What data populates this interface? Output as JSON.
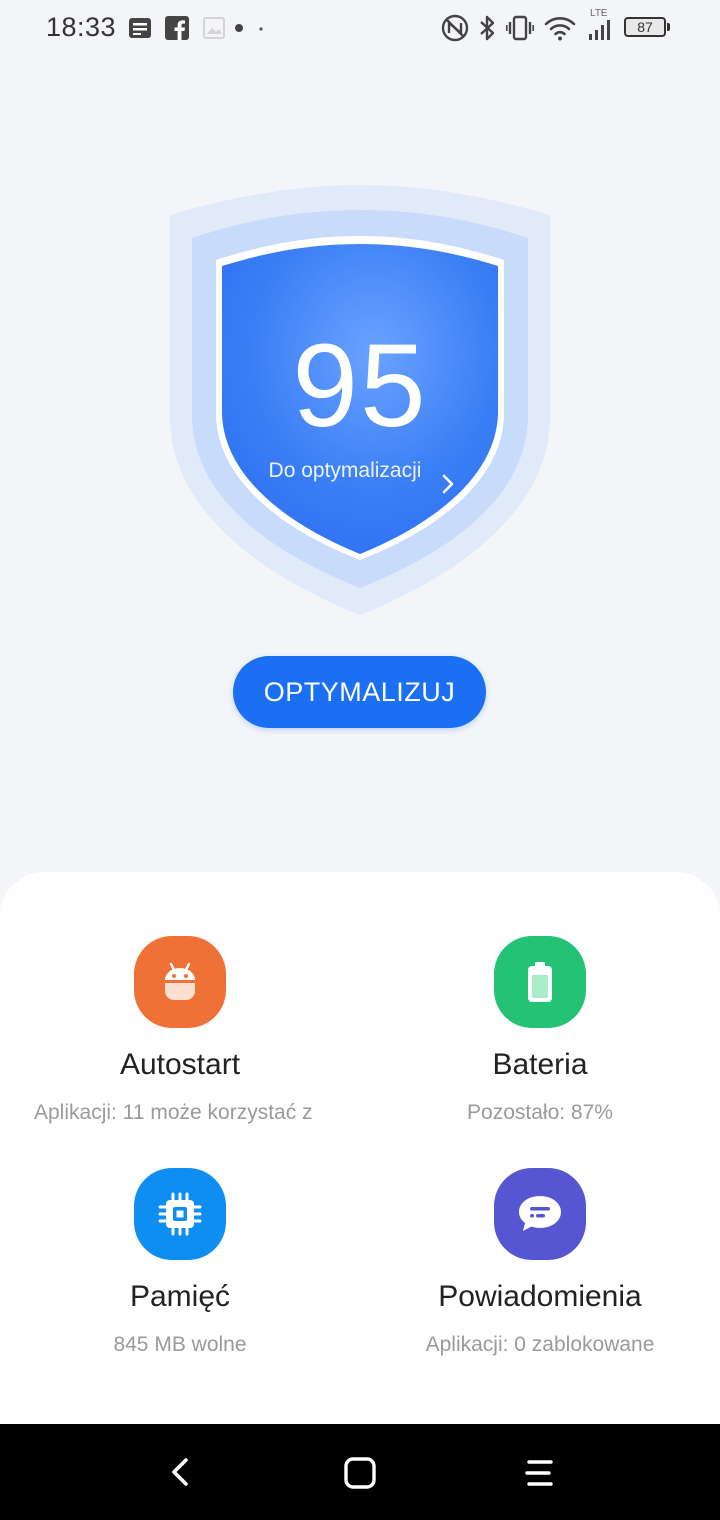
{
  "status_bar": {
    "time": "18:33",
    "battery_level": "87",
    "network_label": "LTE",
    "left_icons": [
      "notes-icon",
      "facebook-icon",
      "image-icon",
      "dot-icon",
      "small-dot-icon"
    ],
    "right_icons": [
      "nfc-icon",
      "bluetooth-icon",
      "vibrate-icon",
      "wifi-icon",
      "signal-icon",
      "battery-icon"
    ]
  },
  "security": {
    "score": "95",
    "label": "Do optymalizacji",
    "optimize_button": "OPTYMALIZUJ",
    "shield_color": "#3a7ef5"
  },
  "tiles": [
    {
      "title": "Autostart",
      "subtitle": "Aplikacji: 11 może korzystać z",
      "icon": "android-icon",
      "color": "#f07138"
    },
    {
      "title": "Bateria",
      "subtitle": "Pozostało: 87%",
      "icon": "battery-icon",
      "color": "#23c274"
    },
    {
      "title": "Pamięć",
      "subtitle": "845 MB wolne",
      "icon": "chip-icon",
      "color": "#0f8ef2"
    },
    {
      "title": "Powiadomienia",
      "subtitle": "Aplikacji: 0 zablokowane",
      "icon": "message-icon",
      "color": "#5655d2"
    }
  ],
  "nav_bar": {
    "buttons": [
      "back-icon",
      "home-icon",
      "menu-icon"
    ]
  }
}
